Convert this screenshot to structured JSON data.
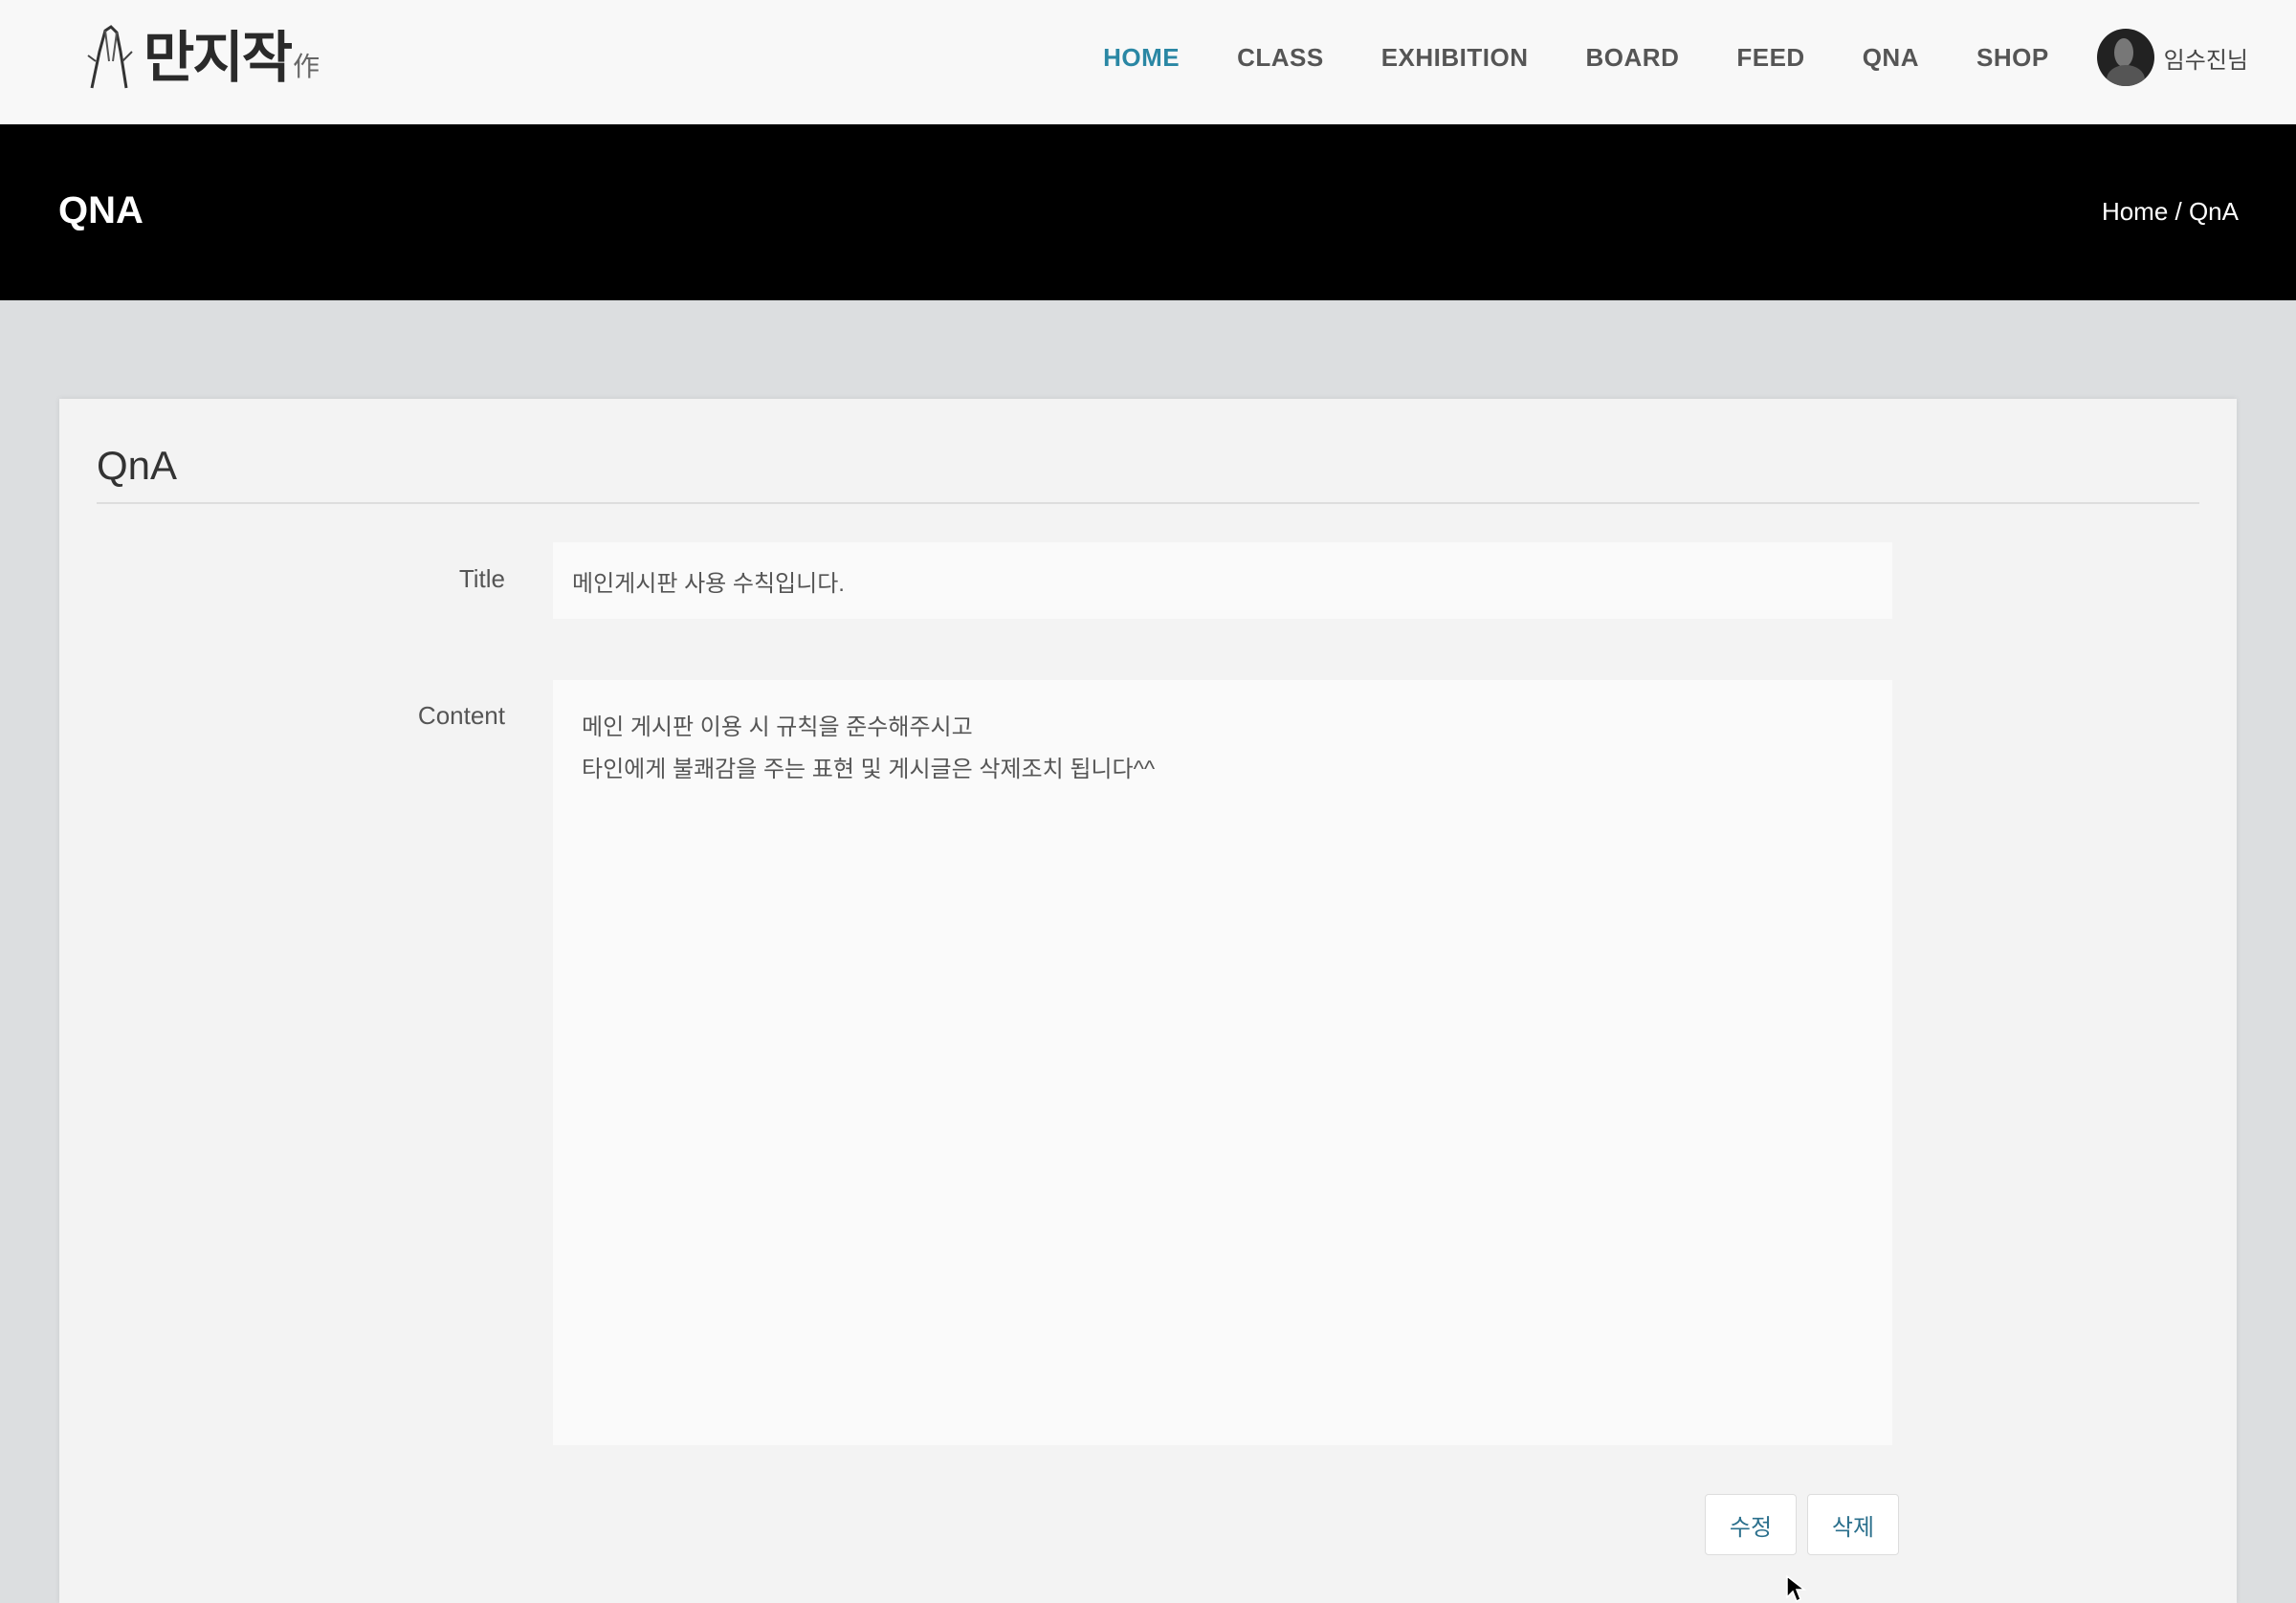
{
  "logo": {
    "text": "만지작",
    "sub": "作"
  },
  "nav": {
    "items": [
      {
        "label": "HOME",
        "active": true
      },
      {
        "label": "CLASS"
      },
      {
        "label": "EXHIBITION"
      },
      {
        "label": "BOARD"
      },
      {
        "label": "FEED"
      },
      {
        "label": "QNA"
      },
      {
        "label": "SHOP"
      }
    ],
    "user_name": "임수진님"
  },
  "banner": {
    "title": "QNA",
    "breadcrumb": "Home / QnA"
  },
  "panel": {
    "title": "QnA",
    "title_label": "Title",
    "title_value": "메인게시판 사용 수칙입니다.",
    "content_label": "Content",
    "content_lines": [
      "메인 게시판 이용 시 규칙을 준수해주시고",
      "타인에게 불쾌감을 주는 표현 및 게시글은 삭제조치 됩니다^^"
    ],
    "edit_label": "수정",
    "delete_label": "삭제"
  },
  "colors": {
    "accent": "#2a87a4",
    "banner": "#000000",
    "button_text": "#2a6f8c"
  }
}
